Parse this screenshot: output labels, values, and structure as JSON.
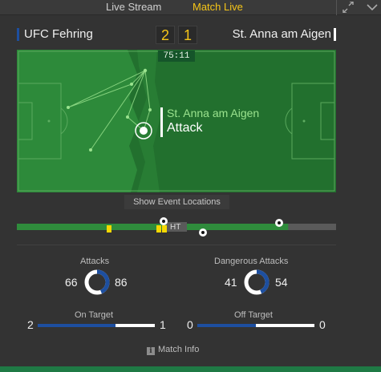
{
  "tabs": {
    "live_stream": "Live Stream",
    "match_live": "Match Live"
  },
  "colors": {
    "accent": "#f5c518",
    "home_team": "#1d4fa0",
    "away_team": "#ffffff",
    "pitch": "#2d8a3a",
    "event_team": "#9be38e"
  },
  "scoreboard": {
    "home_team": "UFC Fehring",
    "away_team": "St. Anna am Aigen",
    "home_score": "2",
    "away_score": "1"
  },
  "pitch": {
    "clock": "75:11",
    "event_team": "St. Anna am Aigen",
    "event_type": "Attack"
  },
  "show_event_locations": "Show Event Locations",
  "timeline": {
    "ht_label": "HT",
    "progress": 0.85
  },
  "stats": {
    "attacks": {
      "label": "Attacks",
      "home": "66",
      "away": "86"
    },
    "dangerous_attacks": {
      "label": "Dangerous Attacks",
      "home": "41",
      "away": "54"
    },
    "on_target": {
      "label": "On Target",
      "home": "2",
      "away": "1"
    },
    "off_target": {
      "label": "Off Target",
      "home": "0",
      "away": "0"
    }
  },
  "match_info": "Match Info",
  "icons": {
    "expand": "expand-icon",
    "collapse": "collapse-icon",
    "ball": "ball-icon",
    "yellow_card": "yellow-card-icon",
    "info": "info-icon"
  }
}
